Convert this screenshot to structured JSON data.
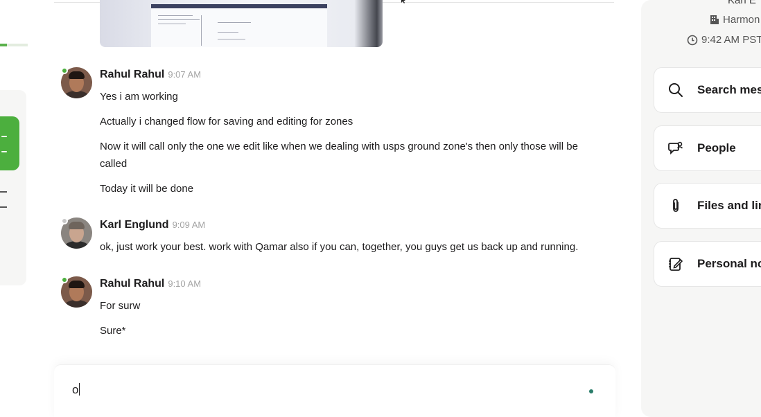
{
  "left_panel": {
    "progress_fraction": 0.25
  },
  "messages": [
    {
      "sender": "Rahul Rahul",
      "time": "9:07 AM",
      "lines": [
        "Yes i am working",
        "Actually i changed flow for saving and editing for zones",
        "Now it will call only the one we edit like when we dealing with usps ground zone's then only those will be called",
        "Today it will be done"
      ]
    },
    {
      "sender": "Karl Englund",
      "time": "9:09 AM",
      "lines": [
        "ok, just work your best. work with Qamar also if you can, together, you guys get us back up and running."
      ]
    },
    {
      "sender": "Rahul Rahul",
      "time": "9:10 AM",
      "lines": [
        "For surw",
        "Sure*"
      ]
    }
  ],
  "composer": {
    "value": "o"
  },
  "profile": {
    "name_fragment": "Karl E",
    "org_fragment": "Harmon",
    "local_time": "9:42 AM PST",
    "actions": [
      {
        "label": "Search mes",
        "icon": "search-icon"
      },
      {
        "label": "People",
        "icon": "people-icon"
      },
      {
        "label": "Files and lin",
        "icon": "paperclip-icon"
      },
      {
        "label": "Personal no",
        "icon": "note-edit-icon"
      }
    ]
  },
  "colors": {
    "online": "#4caf3e",
    "away": "#c8c8c8",
    "accent_green": "#4caf3e",
    "send_dot": "#2a7d6a"
  }
}
